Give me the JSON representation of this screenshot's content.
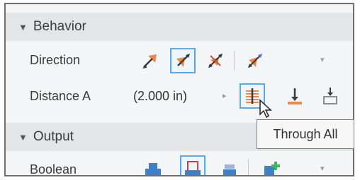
{
  "behavior": {
    "title": "Behavior",
    "direction_label": "Direction",
    "distance_label": "Distance A",
    "distance_value": "(2.000 in)"
  },
  "output": {
    "title": "Output",
    "boolean_label": "Boolean"
  },
  "tooltip": {
    "text": "Through All"
  },
  "icons": {
    "accent": "#e8894a",
    "dark": "#3a3a3a",
    "selected_border": "#5aa9e6",
    "boolean_blue": "#3f7fc8"
  }
}
